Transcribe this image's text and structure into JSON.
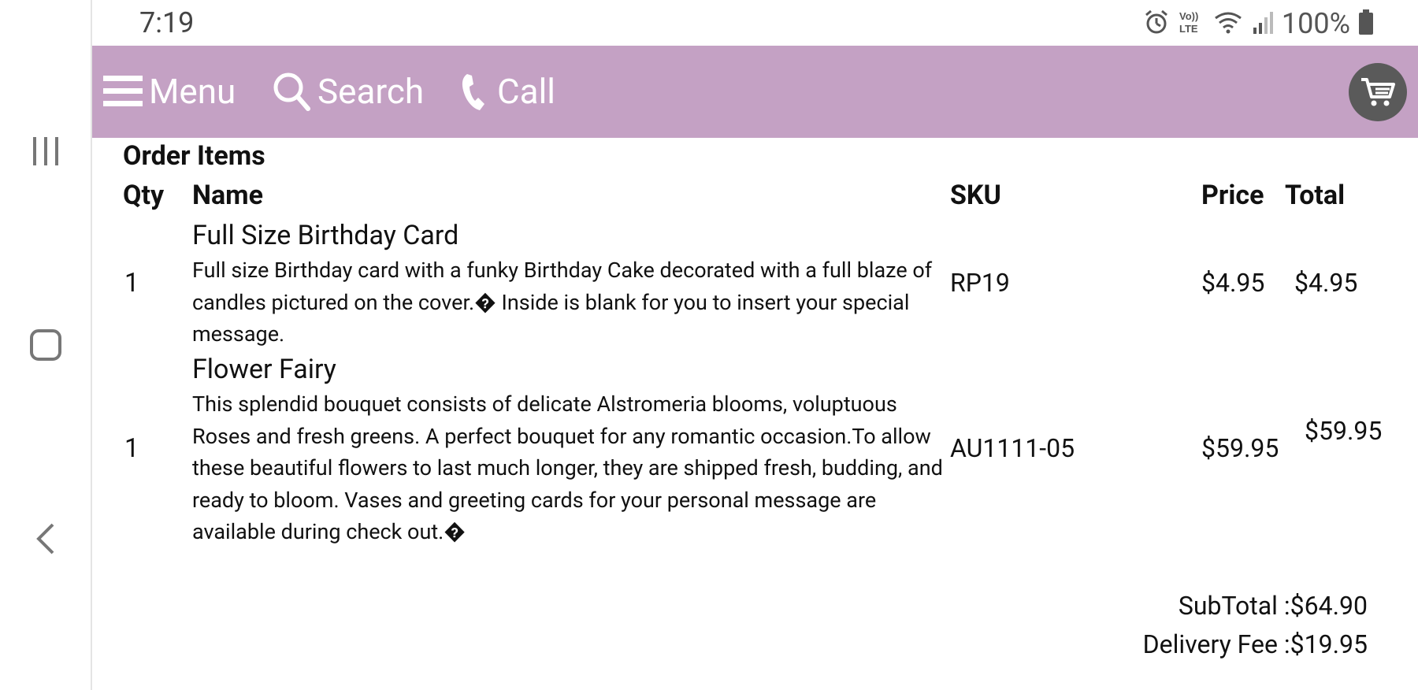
{
  "status_bar": {
    "time": "7:19",
    "battery": "100%",
    "icons": [
      "alarm-icon",
      "volte-icon",
      "wifi-icon",
      "signal-icon",
      "battery-icon"
    ]
  },
  "header": {
    "background": "#c4a1c4",
    "menu_label": "Menu",
    "search_label": "Search",
    "call_label": "Call",
    "cart_icon": "cart-icon"
  },
  "order": {
    "title": "Order Items",
    "columns": {
      "qty": "Qty",
      "name": "Name",
      "sku": "SKU",
      "price": "Price",
      "total": "Total"
    },
    "items": [
      {
        "qty": "1",
        "name": "Full Size Birthday Card",
        "description": "Full size Birthday card with a funky Birthday Cake decorated with a full blaze of candles pictured on the cover.� Inside is blank for you to insert your special message.",
        "sku": "RP19",
        "price": "$4.95",
        "total": "$4.95"
      },
      {
        "qty": "1",
        "name": "Flower Fairy",
        "description": "This splendid bouquet consists of delicate Alstromeria blooms, voluptuous Roses and fresh greens. A perfect bouquet for any romantic occasion.To allow these beautiful flowers to last much longer, they are shipped fresh, budding, and ready to bloom. Vases and greeting cards for your personal message are available during check out.�",
        "sku": "AU1111-05",
        "price": "$59.95",
        "total": "$59.95"
      }
    ],
    "subtotal": "SubTotal :$64.90",
    "delivery_fee": "Delivery Fee :$19.95"
  },
  "system_nav": [
    "recents-icon",
    "home-icon",
    "back-icon"
  ]
}
